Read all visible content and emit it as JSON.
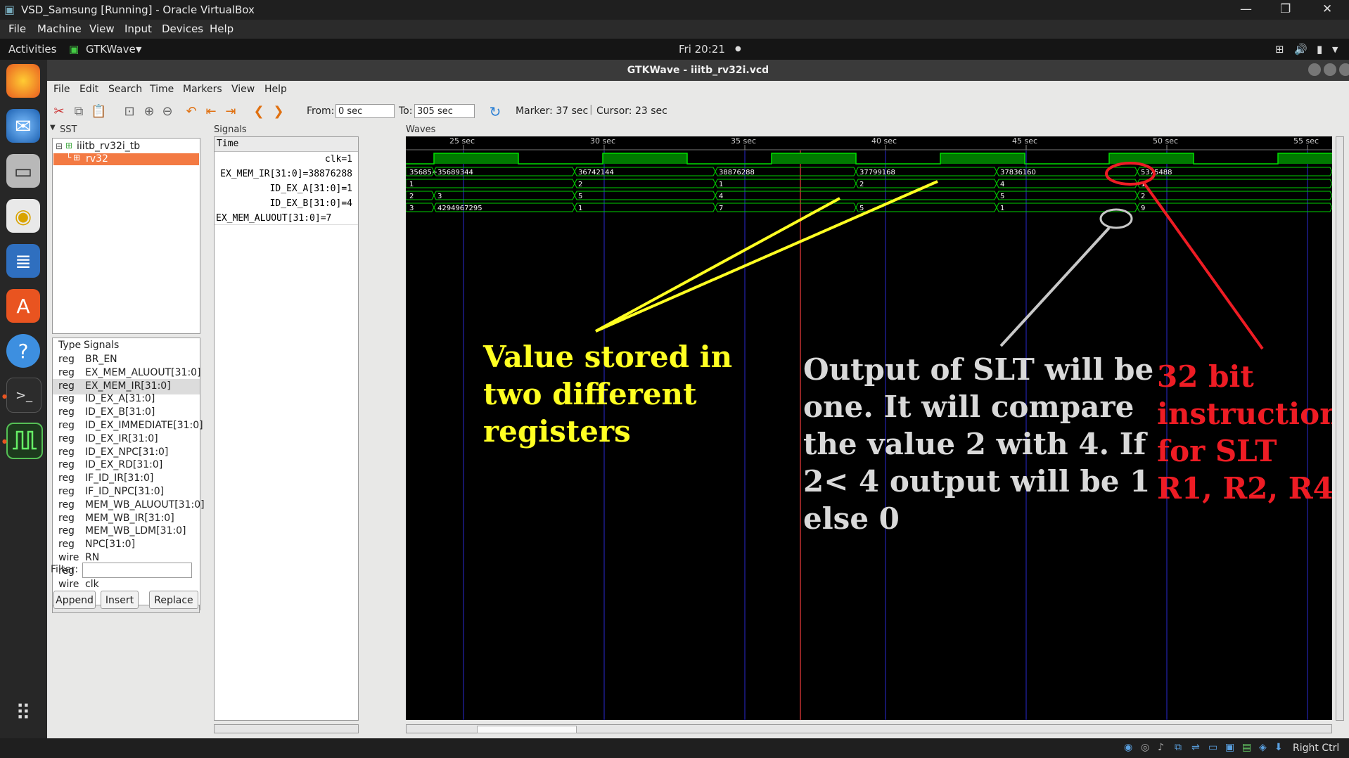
{
  "vbox": {
    "title": "VSD_Samsung [Running] - Oracle VirtualBox",
    "menu": [
      "File",
      "Machine",
      "View",
      "Input",
      "Devices",
      "Help"
    ],
    "host_key": "Right Ctrl"
  },
  "topbar": {
    "activities": "Activities",
    "app": "GTKWave",
    "clock": "Fri 20:21"
  },
  "gtkwave": {
    "title": "GTKWave - iiitb_rv32i.vcd",
    "menu": [
      "File",
      "Edit",
      "Search",
      "Time",
      "Markers",
      "View",
      "Help"
    ],
    "from_label": "From:",
    "from_value": "0 sec",
    "to_label": "To:",
    "to_value": "305 sec",
    "marker_text": "Marker: 37 sec",
    "cursor_text": "Cursor: 23 sec",
    "sst_label": "SST",
    "tree": {
      "root": "iiitb_rv32i_tb",
      "child": "rv32"
    },
    "signals_list_header": {
      "type": "Type",
      "signals": "Signals"
    },
    "signals_list": [
      {
        "type": "reg",
        "name": "BR_EN"
      },
      {
        "type": "reg",
        "name": "EX_MEM_ALUOUT[31:0]"
      },
      {
        "type": "reg",
        "name": "EX_MEM_IR[31:0]"
      },
      {
        "type": "reg",
        "name": "ID_EX_A[31:0]"
      },
      {
        "type": "reg",
        "name": "ID_EX_B[31:0]"
      },
      {
        "type": "reg",
        "name": "ID_EX_IMMEDIATE[31:0]"
      },
      {
        "type": "reg",
        "name": "ID_EX_IR[31:0]"
      },
      {
        "type": "reg",
        "name": "ID_EX_NPC[31:0]"
      },
      {
        "type": "reg",
        "name": "ID_EX_RD[31:0]"
      },
      {
        "type": "reg",
        "name": "IF_ID_IR[31:0]"
      },
      {
        "type": "reg",
        "name": "IF_ID_NPC[31:0]"
      },
      {
        "type": "reg",
        "name": "MEM_WB_ALUOUT[31:0]"
      },
      {
        "type": "reg",
        "name": "MEM_WB_IR[31:0]"
      },
      {
        "type": "reg",
        "name": "MEM_WB_LDM[31:0]"
      },
      {
        "type": "reg",
        "name": "NPC[31:0]"
      },
      {
        "type": "wire",
        "name": "RN"
      },
      {
        "type": "reg",
        "name": "WB_OUT[31:0]"
      },
      {
        "type": "wire",
        "name": "clk"
      }
    ],
    "filter_label": "Filter:",
    "buttons": {
      "append": "Append",
      "insert": "Insert",
      "replace": "Replace"
    },
    "signals_pane_label": "Signals",
    "waves_pane_label": "Waves",
    "time_header": "Time",
    "signal_values": [
      "clk=1",
      "EX_MEM_IR[31:0]=38876288",
      "ID_EX_A[31:0]=1",
      "ID_EX_B[31:0]=4",
      "EX_MEM_ALUOUT[31:0]=7"
    ],
    "time_ticks": [
      "25 sec",
      "30 sec",
      "35 sec",
      "40 sec",
      "45 sec",
      "50 sec",
      "55 sec"
    ],
    "wave_values": {
      "ex_mem_ir": [
        "35685+",
        "35689344",
        "36742144",
        "38876288",
        "37799168",
        "37836160",
        "5375488"
      ],
      "id_ex_a": [
        "1",
        "2",
        "1",
        "2",
        "4",
        "1"
      ],
      "id_ex_b": [
        "2",
        "3",
        "5",
        "4",
        "5",
        "2"
      ],
      "ex_mem_aluout": [
        "3",
        "4294967295",
        "1",
        "7",
        "5",
        "1",
        "9"
      ]
    }
  },
  "annotations": {
    "yellow": [
      "Value stored in",
      "two different",
      "registers"
    ],
    "white": [
      "Output of SLT will be",
      "one. It will compare",
      "the value 2 with 4. If",
      "2< 4 output will be 1",
      "else 0"
    ],
    "red": [
      "32 bit",
      "instruction",
      "for SLT",
      "R1, R2, R4"
    ]
  },
  "colors": {
    "annot_yellow": "#ffff22",
    "annot_white": "#d9d9d9",
    "annot_red": "#ee1c24",
    "wave_green": "#00c000",
    "selection_orange": "#f37a43"
  }
}
